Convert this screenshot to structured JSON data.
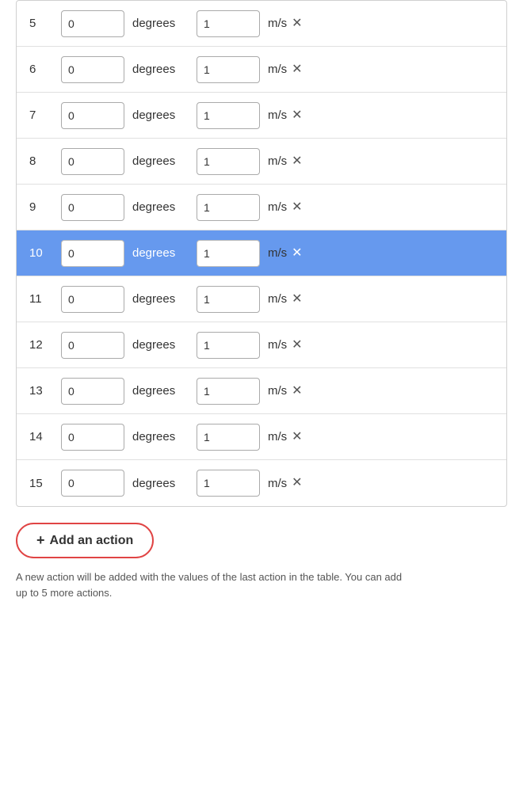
{
  "table": {
    "rows": [
      {
        "id": 5,
        "angle": "0",
        "speed": "1",
        "highlighted": false
      },
      {
        "id": 6,
        "angle": "0",
        "speed": "1",
        "highlighted": false
      },
      {
        "id": 7,
        "angle": "0",
        "speed": "1",
        "highlighted": false
      },
      {
        "id": 8,
        "angle": "0",
        "speed": "1",
        "highlighted": false
      },
      {
        "id": 9,
        "angle": "0",
        "speed": "1",
        "highlighted": false
      },
      {
        "id": 10,
        "angle": "0",
        "speed": "1",
        "highlighted": true
      },
      {
        "id": 11,
        "angle": "0",
        "speed": "1",
        "highlighted": false
      },
      {
        "id": 12,
        "angle": "0",
        "speed": "1",
        "highlighted": false
      },
      {
        "id": 13,
        "angle": "0",
        "speed": "1",
        "highlighted": false
      },
      {
        "id": 14,
        "angle": "0",
        "speed": "1",
        "highlighted": false
      },
      {
        "id": 15,
        "angle": "0",
        "speed": "1",
        "highlighted": false
      }
    ],
    "angle_unit": "degrees",
    "speed_unit": "m/s"
  },
  "add_action_button": {
    "label": "Add an action",
    "plus": "+"
  },
  "hint": {
    "text": "A new action will be added with the values of the last action in the table. You can add up to 5 more actions."
  }
}
